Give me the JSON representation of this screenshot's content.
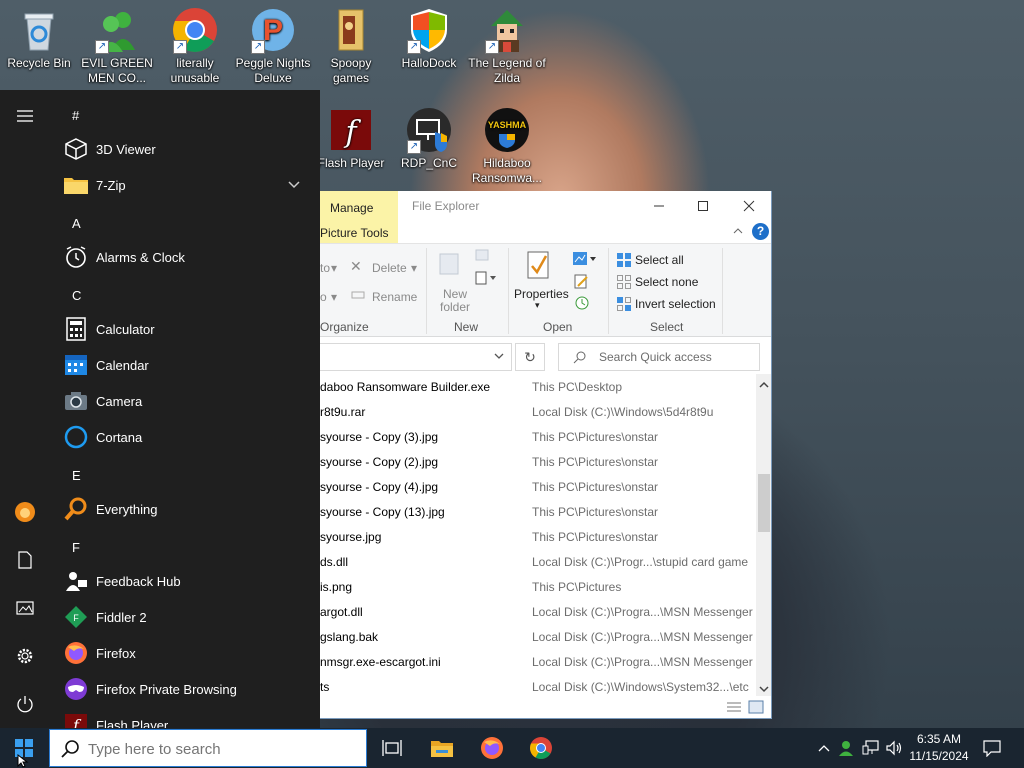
{
  "desktop": {
    "icons": [
      {
        "label": "Recycle Bin",
        "icon": "recycle-bin-icon"
      },
      {
        "label": "EVIL GREEN MEN CO...",
        "icon": "messenger-buddies-icon"
      },
      {
        "label": "literally unusable",
        "icon": "chrome-icon"
      },
      {
        "label": "Peggle Nights Deluxe",
        "icon": "peggle-icon"
      },
      {
        "label": "Spoopy games",
        "icon": "folder-icon"
      },
      {
        "label": "HalloDock",
        "icon": "windows-shield-icon"
      },
      {
        "label": "The Legend of Zilda",
        "icon": "zilda-icon"
      },
      {
        "label": "Flash Player",
        "icon": "flash-player-icon"
      },
      {
        "label": "RDP_CnC",
        "icon": "rdp-icon"
      },
      {
        "label": "Hildaboo Ransomwa...",
        "icon": "yashma-icon"
      }
    ],
    "yashma_text": "YASHMA"
  },
  "start_menu": {
    "letters": [
      "#",
      "A",
      "C",
      "E",
      "F"
    ],
    "apps": [
      {
        "label": "3D Viewer",
        "icon": "cube-icon"
      },
      {
        "label": "7-Zip",
        "icon": "folder-icon"
      },
      {
        "label": "Alarms & Clock",
        "icon": "alarm-clock-icon"
      },
      {
        "label": "Calculator",
        "icon": "calculator-icon"
      },
      {
        "label": "Calendar",
        "icon": "calendar-icon"
      },
      {
        "label": "Camera",
        "icon": "camera-icon"
      },
      {
        "label": "Cortana",
        "icon": "cortana-icon"
      },
      {
        "label": "Everything",
        "icon": "magnifier-icon"
      },
      {
        "label": "Feedback Hub",
        "icon": "feedback-icon"
      },
      {
        "label": "Fiddler 2",
        "icon": "fiddler-icon"
      },
      {
        "label": "Firefox",
        "icon": "firefox-icon"
      },
      {
        "label": "Firefox Private Browsing",
        "icon": "firefox-private-icon"
      },
      {
        "label": "Flash Player",
        "icon": "flash-player-icon"
      }
    ]
  },
  "explorer": {
    "manage_tab": "Manage",
    "picture_tools": "Picture Tools",
    "title": "File Explorer",
    "ribbon": {
      "delete": "Delete",
      "rename": "Rename",
      "new_folder_line1": "New",
      "new_folder_line2": "folder",
      "properties": "Properties",
      "select_all": "Select all",
      "select_none": "Select none",
      "invert_selection": "Invert selection",
      "group_organize": "Organize",
      "group_new": "New",
      "group_open": "Open",
      "group_select": "Select",
      "cut_text_1": "to",
      "cut_text_2": "o"
    },
    "search_placeholder": "Search Quick access",
    "files": [
      {
        "name": "daboo Ransomware Builder.exe",
        "location": "This PC\\Desktop"
      },
      {
        "name": "r8t9u.rar",
        "location": "Local Disk (C:)\\Windows\\5d4r8t9u"
      },
      {
        "name": "syourse - Copy (3).jpg",
        "location": "This PC\\Pictures\\onstar"
      },
      {
        "name": "syourse - Copy (2).jpg",
        "location": "This PC\\Pictures\\onstar"
      },
      {
        "name": "syourse - Copy (4).jpg",
        "location": "This PC\\Pictures\\onstar"
      },
      {
        "name": "syourse - Copy (13).jpg",
        "location": "This PC\\Pictures\\onstar"
      },
      {
        "name": "syourse.jpg",
        "location": "This PC\\Pictures\\onstar"
      },
      {
        "name": "ds.dll",
        "location": "Local Disk (C:)\\Progr...\\stupid card game"
      },
      {
        "name": "is.png",
        "location": "This PC\\Pictures"
      },
      {
        "name": "argot.dll",
        "location": "Local Disk (C:)\\Progra...\\MSN Messenger"
      },
      {
        "name": "gslang.bak",
        "location": "Local Disk (C:)\\Progra...\\MSN Messenger"
      },
      {
        "name": "nmsgr.exe-escargot.ini",
        "location": "Local Disk (C:)\\Progra...\\MSN Messenger"
      },
      {
        "name": "ts",
        "location": "Local Disk (C:)\\Windows\\System32...\\etc"
      }
    ]
  },
  "taskbar": {
    "search_placeholder": "Type here to search",
    "time": "6:35 AM",
    "date": "11/15/2024",
    "pinned": [
      "task-view-icon",
      "file-explorer-icon",
      "firefox-icon",
      "chrome-icon"
    ]
  }
}
